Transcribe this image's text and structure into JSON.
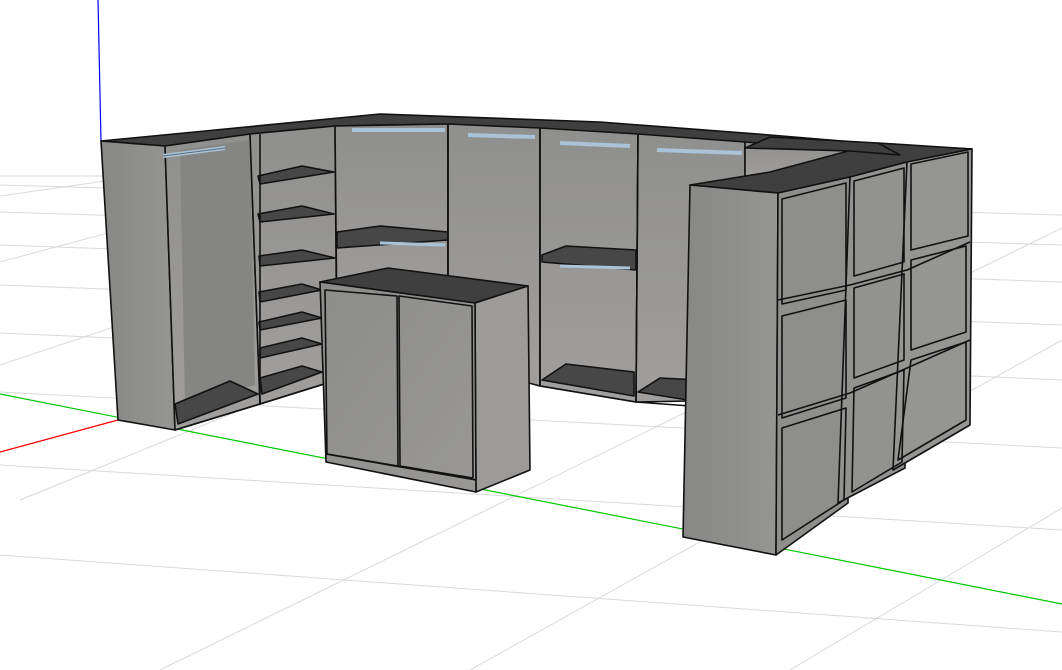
{
  "viewport": {
    "background": "#ffffff",
    "grid_color": "#d9d9d9",
    "axis_colors": {
      "x": "#ff0000",
      "y": "#00c800",
      "z": "#0000ff"
    }
  },
  "model": {
    "body_color": "#8e8e8c",
    "side_color": "#8a8a88",
    "top_color": "#3f3f3f",
    "interior_color": "#9a9a98",
    "shelf_color": "#474747",
    "rail_color": "#a9c3d8",
    "edge_color": "#111111"
  }
}
